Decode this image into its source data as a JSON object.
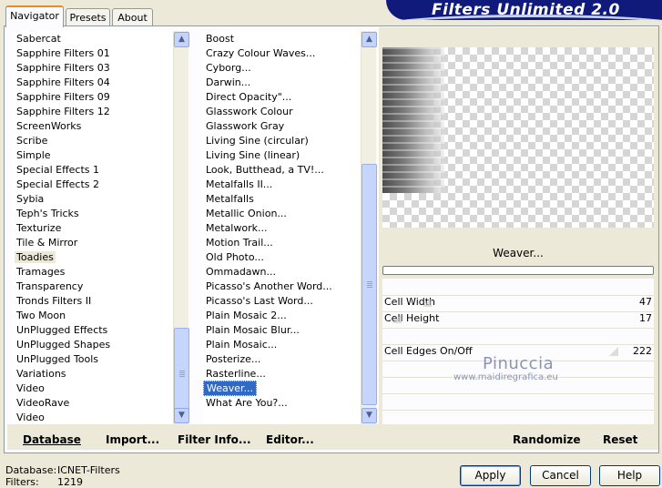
{
  "tabs": [
    "Navigator",
    "Presets",
    "About"
  ],
  "banner_title": "Filters Unlimited 2.0",
  "categories": {
    "items": [
      "Sabercat",
      "Sapphire Filters 01",
      "Sapphire Filters 03",
      "Sapphire Filters 04",
      "Sapphire Filters 09",
      "Sapphire Filters 12",
      "ScreenWorks",
      "Scribe",
      "Simple",
      "Special Effects 1",
      "Special Effects 2",
      "Sybia",
      "Teph's Tricks",
      "Texturize",
      "Tile & Mirror",
      "Toadies",
      "Tramages",
      "Transparency",
      "Tronds Filters II",
      "Two Moon",
      "UnPlugged Effects",
      "UnPlugged Shapes",
      "UnPlugged Tools",
      "Variations",
      "Video",
      "VideoRave",
      "Video"
    ],
    "selected": "Toadies"
  },
  "filters": {
    "items": [
      "Boost",
      "Crazy Colour Waves...",
      "Cyborg...",
      "Darwin...",
      "Direct Opacity\"...",
      "Glasswork Colour",
      "Glasswork Gray",
      "Living Sine (circular)",
      "Living Sine (linear)",
      "Look, Butthead, a TV!...",
      "Metalfalls II...",
      "Metalfalls",
      "Metallic Onion...",
      "Metalwork...",
      "Motion Trail...",
      "Old Photo...",
      "Ommadawn...",
      "Picasso's Another Word...",
      "Picasso's Last Word...",
      "Plain Mosaic 2...",
      "Plain Mosaic Blur...",
      "Plain Mosaic...",
      "Posterize...",
      "Rasterline...",
      "Weaver...",
      "What Are You?..."
    ],
    "selected": "Weaver..."
  },
  "toolbar": {
    "database": "Database",
    "import": "Import...",
    "filter_info": "Filter Info...",
    "editor": "Editor...",
    "randomize": "Randomize",
    "reset": "Reset"
  },
  "filter_name": "Weaver...",
  "params": [
    {
      "label": "Cell Width",
      "value": "47",
      "level": 0.18
    },
    {
      "label": "Cell Height",
      "value": "17",
      "level": 0.07
    },
    {
      "label": "Cell Edges On/Off",
      "value": "222",
      "level": 0.87
    }
  ],
  "watermark": {
    "name": "Pinuccia",
    "site": "www.maidiregrafica.eu"
  },
  "status": {
    "database_label": "Database:",
    "database_value": "ICNET-Filters",
    "filters_label": "Filters:",
    "filters_value": "1219"
  },
  "buttons": {
    "apply": "Apply",
    "cancel": "Cancel",
    "help": "Help"
  }
}
